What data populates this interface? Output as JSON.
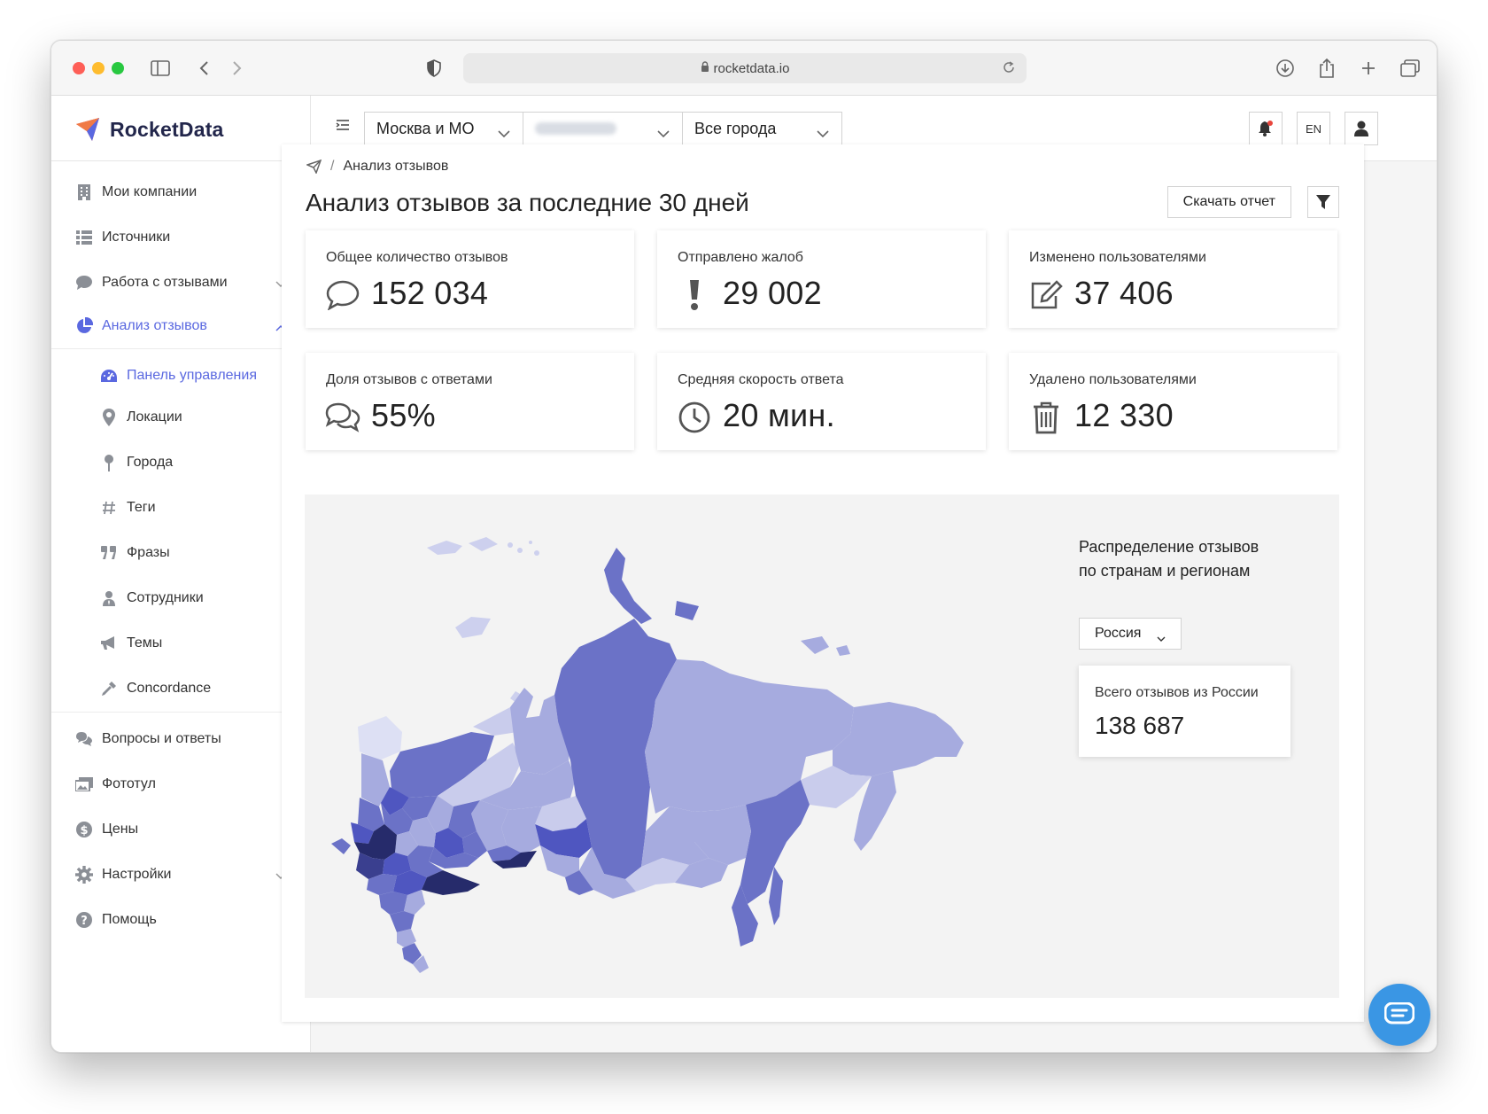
{
  "browser": {
    "url": "rocketdata.io"
  },
  "app": {
    "logo_text": "RocketData"
  },
  "colors": {
    "accent": "#5a68e0",
    "map_dark": "#262b6b",
    "map_mid": "#6b72c7",
    "map_light": "#a6abdf",
    "map_lighter": "#c9ccec",
    "chat": "#3a96e4"
  },
  "sidebar": {
    "items": [
      {
        "label": "Мои компании",
        "icon": "building-icon"
      },
      {
        "label": "Источники",
        "icon": "list-icon"
      },
      {
        "label": "Работа с отзывами",
        "icon": "comment-icon"
      },
      {
        "label": "Анализ отзывов",
        "icon": "pie-chart-icon"
      },
      {
        "label": "Панель управления",
        "icon": "dashboard-icon"
      },
      {
        "label": "Локации",
        "icon": "map-pin-icon"
      },
      {
        "label": "Города",
        "icon": "pushpin-icon"
      },
      {
        "label": "Теги",
        "icon": "hashtag-icon"
      },
      {
        "label": "Фразы",
        "icon": "quote-icon"
      },
      {
        "label": "Сотрудники",
        "icon": "user-tie-icon"
      },
      {
        "label": "Темы",
        "icon": "megaphone-icon"
      },
      {
        "label": "Concordance",
        "icon": "eyedropper-icon"
      },
      {
        "label": "Вопросы и ответы",
        "icon": "comments-icon"
      },
      {
        "label": "Фототул",
        "icon": "images-icon"
      },
      {
        "label": "Цены",
        "icon": "dollar-icon"
      },
      {
        "label": "Настройки",
        "icon": "gear-icon"
      },
      {
        "label": "Помощь",
        "icon": "question-icon"
      }
    ]
  },
  "topbar": {
    "region": "Москва и МО",
    "city": "Все города",
    "lang": "EN"
  },
  "page": {
    "breadcrumb": "Анализ отзывов",
    "title": "Анализ отзывов за последние 30 дней",
    "download_label": "Скачать отчет"
  },
  "stats": [
    {
      "label": "Общее количество отзывов",
      "value": "152 034",
      "icon": "comment-icon"
    },
    {
      "label": "Отправлено жалоб",
      "value": "29 002",
      "icon": "exclamation-icon"
    },
    {
      "label": "Изменено пользователями",
      "value": "37 406",
      "icon": "edit-icon"
    },
    {
      "label": "Доля отзывов с ответами",
      "value": "55%",
      "icon": "comments-icon"
    },
    {
      "label": "Средняя скорость ответа",
      "value": "20 мин.",
      "icon": "clock-icon"
    },
    {
      "label": "Удалено пользователями",
      "value": "12 330",
      "icon": "trash-icon"
    }
  ],
  "map": {
    "title_line1": "Распределение отзывов",
    "title_line2": "по странам и регионам",
    "country_select": "Россия",
    "total_label": "Всего отзывов из России",
    "total_value": "138 687"
  }
}
